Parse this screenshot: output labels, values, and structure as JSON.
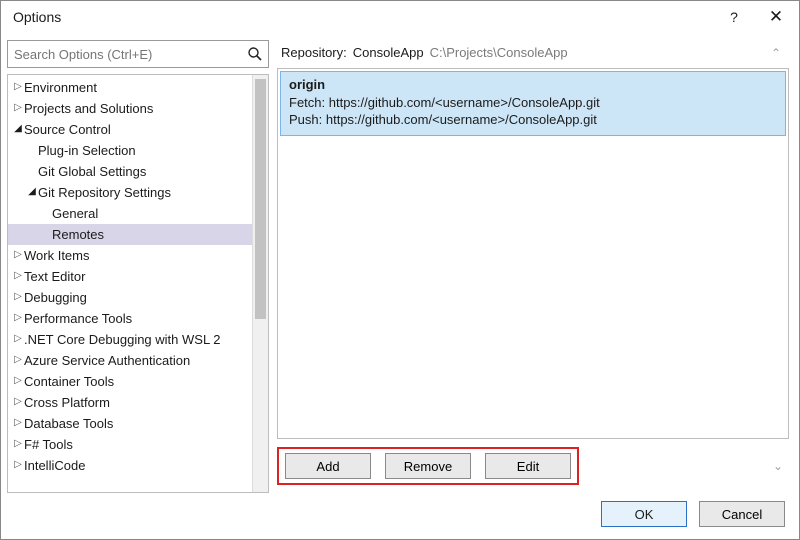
{
  "title": "Options",
  "help_icon": "?",
  "close_icon": "✕",
  "search": {
    "placeholder": "Search Options (Ctrl+E)",
    "icon": "⌕"
  },
  "tree": {
    "environment": "Environment",
    "projects": "Projects and Solutions",
    "source_control": "Source Control",
    "plugin": "Plug-in Selection",
    "git_global": "Git Global Settings",
    "git_repo": "Git Repository Settings",
    "general": "General",
    "remotes": "Remotes",
    "work_items": "Work Items",
    "text_editor": "Text Editor",
    "debugging": "Debugging",
    "perf_tools": "Performance Tools",
    "net_core": ".NET Core Debugging with WSL 2",
    "azure_auth": "Azure Service Authentication",
    "container_tools": "Container Tools",
    "cross_platform": "Cross Platform",
    "db_tools": "Database Tools",
    "fsharp": "F# Tools",
    "intellicode": "IntelliCode"
  },
  "repo": {
    "label": "Repository:",
    "name": "ConsoleApp",
    "path": "C:\\Projects\\ConsoleApp"
  },
  "remote": {
    "name": "origin",
    "fetch_label": "Fetch:",
    "fetch_url": "https://github.com/<username>/ConsoleApp.git",
    "push_label": "Push:",
    "push_url": "https://github.com/<username>/ConsoleApp.git"
  },
  "buttons": {
    "add": "Add",
    "remove": "Remove",
    "edit": "Edit",
    "ok": "OK",
    "cancel": "Cancel"
  }
}
